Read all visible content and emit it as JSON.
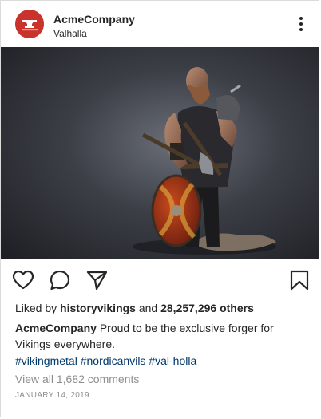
{
  "post": {
    "username": "AcmeCompany",
    "location": "Valhalla",
    "avatar_icon": "anvil-logo-icon",
    "avatar_color": "#c9332b",
    "image_description_icon": "viking-warrior-photo",
    "likes": {
      "prefix": "Liked by",
      "first_liker": "historyvikings",
      "conjunction": "and",
      "others": "28,257,296 others"
    },
    "caption": {
      "user": "AcmeCompany",
      "text": "Proud to be the exclusive forger for Vikings everywhere."
    },
    "hashtags": [
      "#vikingmetal",
      "#nordicanvils",
      "#val-holla"
    ],
    "hashtag_color": "#00376b",
    "view_comments": "View all 1,682 comments",
    "timestamp": "JANUARY 14, 2019"
  }
}
